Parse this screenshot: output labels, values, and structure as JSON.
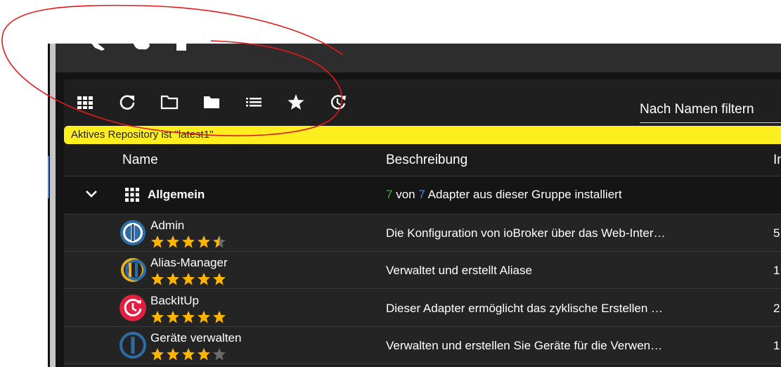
{
  "toolbar": {
    "filter_placeholder": "Nach Namen filtern"
  },
  "banner": {
    "text": "Aktives Repository ist \"latest1\""
  },
  "table": {
    "col_name": "Name",
    "col_description": "Beschreibung",
    "col_installed": "In"
  },
  "group": {
    "name": "Allgemein",
    "installed_count": "7",
    "von": "von",
    "total_count": "7",
    "suffix": "Adapter aus dieser Gruppe installiert"
  },
  "adapters": [
    {
      "name": "Admin",
      "description": "Die Konfiguration von ioBroker über das Web-Inter…",
      "installed": "5",
      "rating": 4.5
    },
    {
      "name": "Alias-Manager",
      "description": "Verwaltet und erstellt Aliase",
      "installed": "1",
      "rating": 5
    },
    {
      "name": "BackItUp",
      "description": "Dieser Adapter ermöglicht das zyklische Erstellen …",
      "installed": "2",
      "rating": 5
    },
    {
      "name": "Geräte verwalten",
      "description": "Verwalten und erstellen Sie Geräte für die Verwen…",
      "installed": "1",
      "rating": 4
    }
  ],
  "colors": {
    "star": "#ffb400",
    "star_empty": "#6b6b6b",
    "installed_green": "#3bb33b",
    "total_blue": "#3b8ff0",
    "banner": "#ffee1f",
    "annotation": "#e01b1b"
  },
  "icons": [
    "wrench-icon",
    "gear-icon",
    "puzzle-icon",
    "grid-icon",
    "refresh-icon",
    "folder-outline-icon",
    "folder-icon",
    "list-icon",
    "star-icon",
    "update-clock-icon",
    "chevron-down-icon"
  ]
}
